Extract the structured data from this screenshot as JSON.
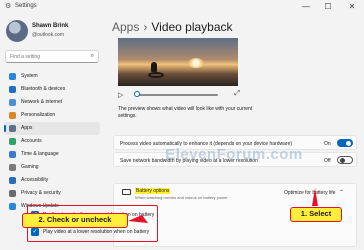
{
  "window": {
    "title": "Settings",
    "minimize": "—",
    "maximize": "☐",
    "close": "✕"
  },
  "user": {
    "name": "Shawn Brink",
    "email": "@outlook.com"
  },
  "search": {
    "placeholder": "Find a setting",
    "icon": "search-icon"
  },
  "sidebar": {
    "items": [
      {
        "label": "System",
        "icon": "system-icon",
        "color": "#2b88d8"
      },
      {
        "label": "Bluetooth & devices",
        "icon": "bluetooth-icon",
        "color": "#1f6fc5"
      },
      {
        "label": "Network & internet",
        "icon": "network-icon",
        "color": "#4a90d9"
      },
      {
        "label": "Personalization",
        "icon": "personalization-icon",
        "color": "#d9872b"
      },
      {
        "label": "Apps",
        "icon": "apps-icon",
        "color": "#5c6f8c",
        "active": true
      },
      {
        "label": "Accounts",
        "icon": "accounts-icon",
        "color": "#2ea36a"
      },
      {
        "label": "Time & language",
        "icon": "time-icon",
        "color": "#3a7bd5"
      },
      {
        "label": "Gaming",
        "icon": "gaming-icon",
        "color": "#7a7a7a"
      },
      {
        "label": "Accessibility",
        "icon": "accessibility-icon",
        "color": "#2b6cb0"
      },
      {
        "label": "Privacy & security",
        "icon": "privacy-icon",
        "color": "#6b6b6b"
      },
      {
        "label": "Windows Update",
        "icon": "update-icon",
        "color": "#2b88d8"
      }
    ]
  },
  "breadcrumb": {
    "parent": "Apps",
    "separator": "›",
    "current": "Video playback"
  },
  "preview": {
    "caption": "The preview shows what video will look like with your current settings.",
    "play": "▷",
    "expand": "⤢"
  },
  "settings": {
    "process_label": "Process video automatically to enhance it (depends on your device hardware)",
    "process_state": "On",
    "bandwidth_label": "Save network bandwidth by playing video at a lower resolution",
    "bandwidth_state": "Off"
  },
  "battery": {
    "title": "Battery options",
    "subtitle": "When watching movies and videos on battery power",
    "dropdown": "Optimize for battery life",
    "checks": [
      {
        "label": "Don't automatically process video when on battery",
        "checked": true
      },
      {
        "label": "Play video at a lower resolution when on battery",
        "checked": true
      }
    ]
  },
  "callouts": {
    "select": "1. Select",
    "check": "2. Check or uncheck"
  },
  "watermark": "ElevenForum.com",
  "colors": {
    "accent": "#0067c0",
    "highlight": "#ffef3a",
    "annotation_red": "#e8102a"
  }
}
